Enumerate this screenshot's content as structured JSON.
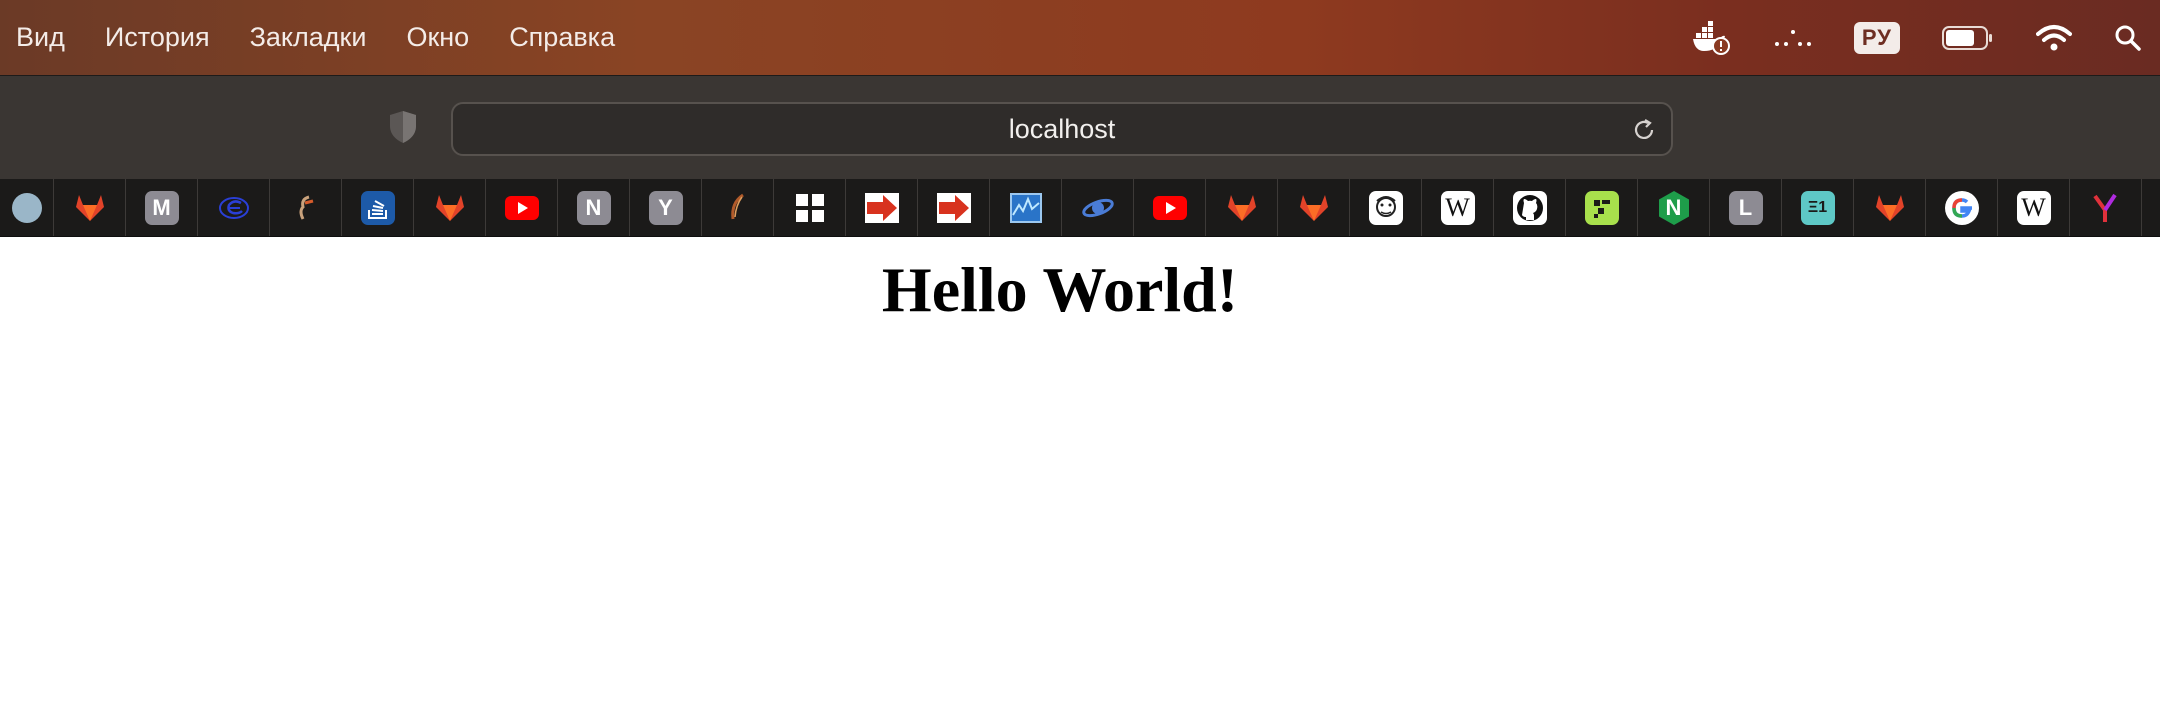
{
  "menubar": {
    "items": [
      "Вид",
      "История",
      "Закладки",
      "Окно",
      "Справка"
    ],
    "language_badge": "РУ"
  },
  "toolbar": {
    "address": "localhost"
  },
  "favorites": [
    {
      "icon": "blue-circle-icon"
    },
    {
      "icon": "gitlab-icon"
    },
    {
      "icon": "m-letter-icon",
      "text": "M"
    },
    {
      "icon": "globe-e-icon"
    },
    {
      "icon": "sketch-figure-icon"
    },
    {
      "icon": "stackoverflow-icon"
    },
    {
      "icon": "gitlab-icon"
    },
    {
      "icon": "youtube-icon"
    },
    {
      "icon": "n-letter-icon",
      "text": "N"
    },
    {
      "icon": "y-letter-icon",
      "text": "Y"
    },
    {
      "icon": "feather-icon"
    },
    {
      "icon": "grid-icon"
    },
    {
      "icon": "red-arrow-icon"
    },
    {
      "icon": "red-arrow-icon"
    },
    {
      "icon": "monitor-chart-icon"
    },
    {
      "icon": "planet-icon"
    },
    {
      "icon": "youtube-icon"
    },
    {
      "icon": "gitlab-icon"
    },
    {
      "icon": "gitlab-icon"
    },
    {
      "icon": "face-sketch-icon"
    },
    {
      "icon": "wikipedia-icon",
      "text": "W"
    },
    {
      "icon": "github-icon"
    },
    {
      "icon": "lime-logo-icon"
    },
    {
      "icon": "nginx-icon",
      "text": "N"
    },
    {
      "icon": "l-letter-icon",
      "text": "L"
    },
    {
      "icon": "teal-logo-icon",
      "text": "Ξ1"
    },
    {
      "icon": "gitlab-icon"
    },
    {
      "icon": "google-icon"
    },
    {
      "icon": "wikipedia-icon",
      "text": "W"
    },
    {
      "icon": "yandex-icon"
    },
    {
      "icon": "google-icon"
    }
  ],
  "page": {
    "heading": "Hello World!"
  },
  "colors": {
    "menubar_gradient_mid": "#8a4424",
    "toolbar_bg": "#3a3633",
    "favbar_bg": "#1b1a19",
    "gitlab_orange": "#e24329",
    "youtube_red": "#ff0000"
  }
}
